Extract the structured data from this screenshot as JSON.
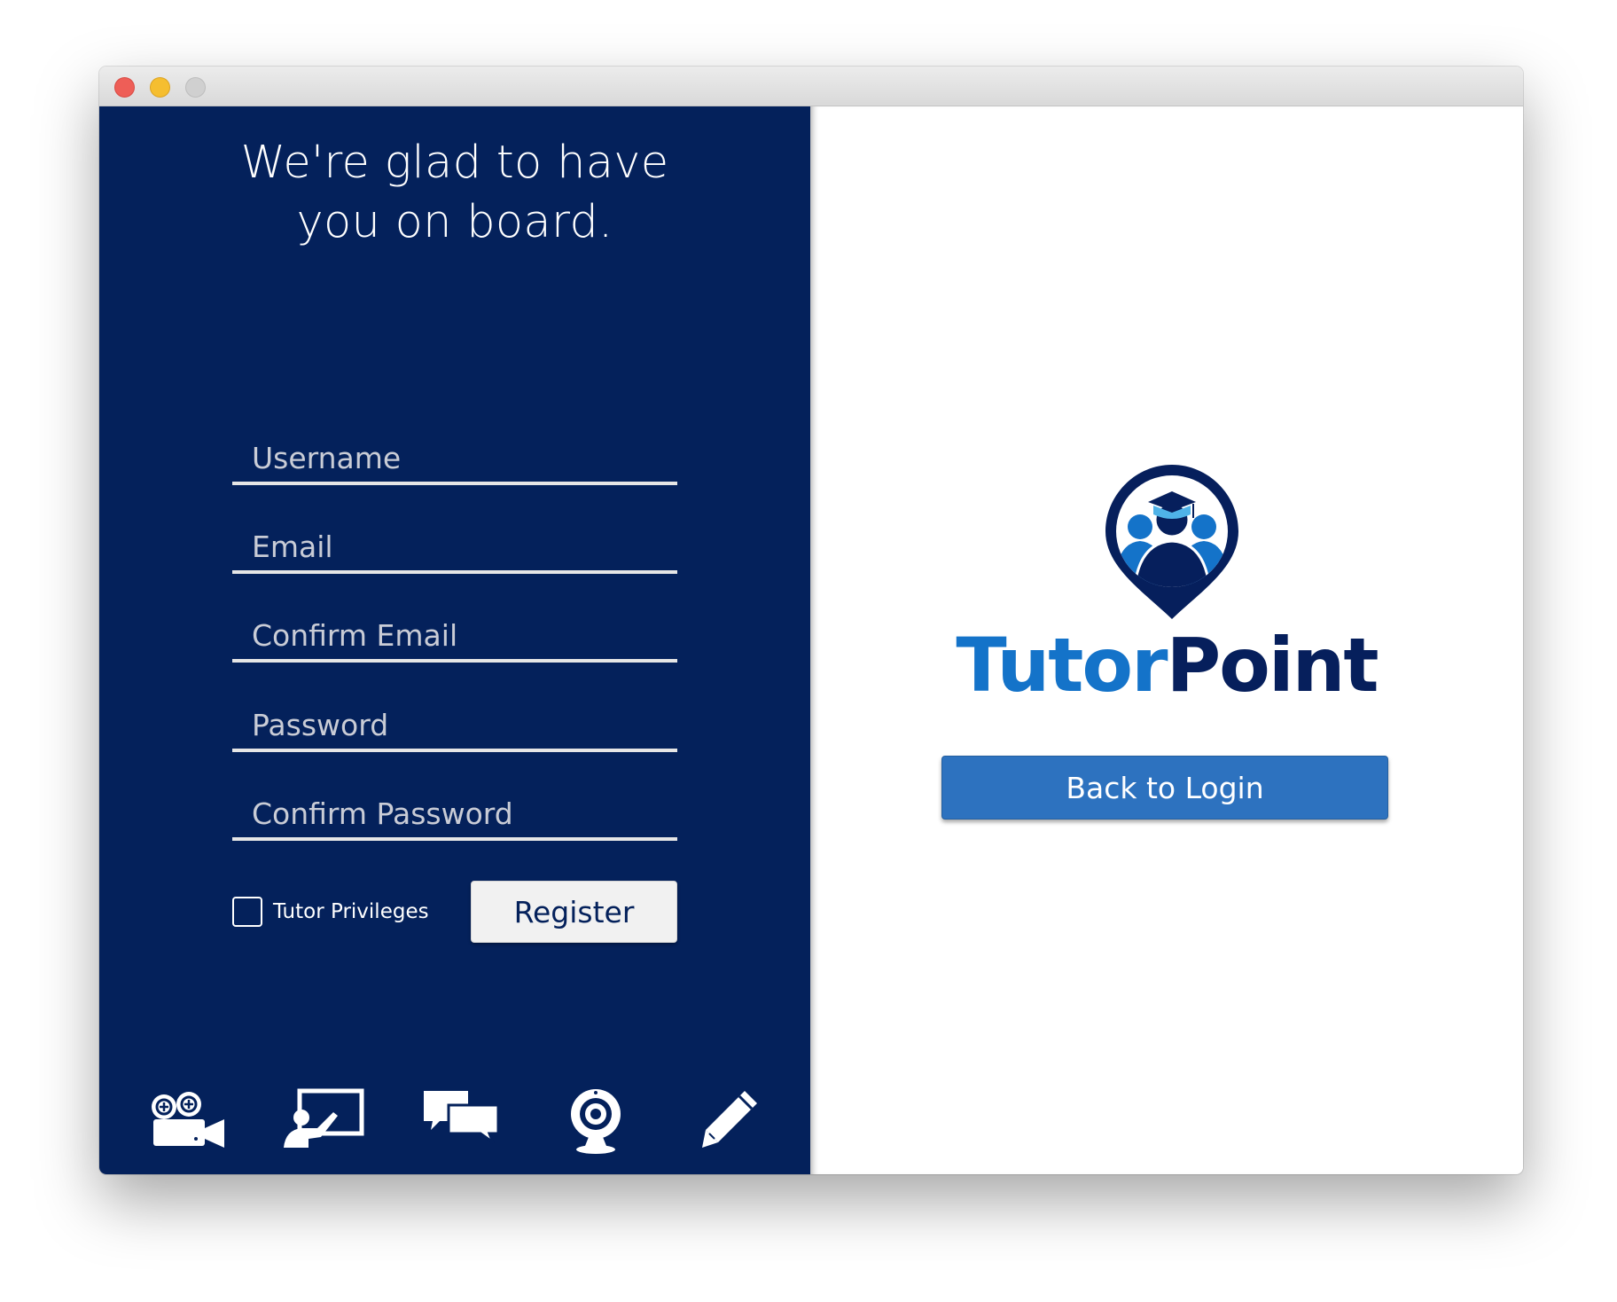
{
  "window": {
    "controls": [
      "close",
      "minimize",
      "maximize"
    ]
  },
  "left_panel": {
    "headline_line1": "We're glad to have",
    "headline_line2": "you on board.",
    "form": {
      "username_placeholder": "Username",
      "email_placeholder": "Email",
      "confirm_email_placeholder": "Confirm Email",
      "password_placeholder": "Password",
      "confirm_password_placeholder": "Confirm Password",
      "username_value": "",
      "email_value": "",
      "confirm_email_value": "",
      "password_value": "",
      "confirm_password_value": "",
      "tutor_privileges_label": "Tutor Privileges",
      "tutor_privileges_checked": false,
      "register_label": "Register"
    },
    "feature_icons": [
      "video-camera-icon",
      "presentation-board-icon",
      "chat-bubbles-icon",
      "webcam-icon",
      "pencil-icon"
    ]
  },
  "right_panel": {
    "brand_part1": "Tutor",
    "brand_part2": "Point",
    "back_to_login_label": "Back to Login"
  },
  "colors": {
    "panel_navy": "#04215b",
    "brand_blue": "#1473c9",
    "brand_navy": "#061f5c",
    "button_blue": "#2d72bf"
  }
}
